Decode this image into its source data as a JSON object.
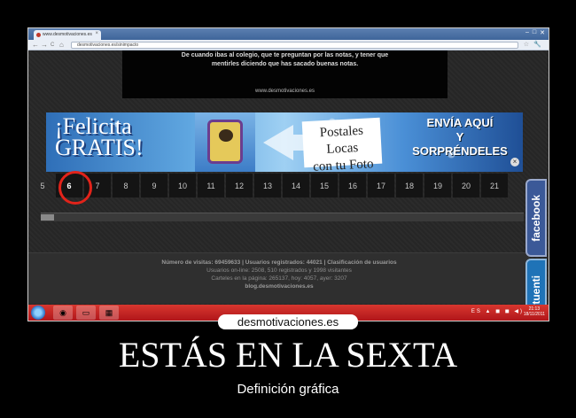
{
  "browser": {
    "tab_title": "www.desmotivaciones.es",
    "address": "desmotivaciones.es/sinimpacto",
    "controls": {
      "back": "←",
      "forward": "→",
      "reload": "C",
      "home": "⌂",
      "star": "☆",
      "wrench": "🔧"
    },
    "window_controls": {
      "minimize": "–",
      "maximize": "□",
      "close": "✕"
    }
  },
  "video": {
    "caption_line1": "De cuando ibas al colegio, que te preguntan por las notas, y tener que",
    "caption_line2": "mentirles diciendo que has sacado buenas notas.",
    "url": "www.desmotivaciones.es"
  },
  "banner": {
    "left_line1": "¡Felicita",
    "left_line2": "GRATIS!",
    "postales_line1": "Postales Locas",
    "postales_line2": "con tu Foto",
    "right_line1": "ENVÍA AQUÍ",
    "right_line2": "Y",
    "right_line3": "SORPRÉNDELES",
    "close": "×"
  },
  "pager": {
    "pages": [
      "5",
      "6",
      "7",
      "8",
      "9",
      "10",
      "11",
      "12",
      "13",
      "14",
      "15",
      "16",
      "17",
      "18",
      "19",
      "20",
      "21"
    ],
    "active_page": "6"
  },
  "social": {
    "facebook": "facebook",
    "tuenti": "tuenti"
  },
  "footer": {
    "line1": "Número de visitas: 69459633 | Usuarios registrados: 44021 | Clasificación de usuarios",
    "line2": "Usuarios on-line: 2508, 510 registrados y 1998 visitantes",
    "line3": "Carteles en la página: 265137, hoy: 4057, ayer: 3207",
    "line4": "blog.desmotivaciones.es"
  },
  "taskbar": {
    "clock_time": "21:13",
    "clock_date": "18/11/2011",
    "tray": "ES ▲ ◼ ◼ ◀)"
  },
  "poster": {
    "logo": "desmotivaciones.es",
    "title": "ESTÁS EN LA SEXTA",
    "subtitle": "Definición gráfica"
  },
  "colors": {
    "highlight_circle": "#e2231a",
    "facebook": "#3b5998",
    "tuenti": "#1f73b7",
    "taskbar": "#c62626"
  }
}
